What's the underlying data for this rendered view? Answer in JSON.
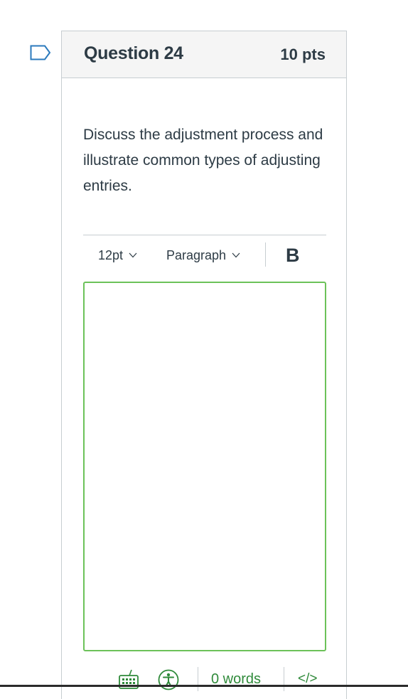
{
  "question": {
    "title": "Question 24",
    "points": "10 pts",
    "text": "Discuss the adjustment process and illustrate common types of adjusting entries."
  },
  "toolbar": {
    "font_size": "12pt",
    "block_format": "Paragraph",
    "bold_label": "B"
  },
  "editor": {
    "content": ""
  },
  "statusbar": {
    "word_count": "0 words",
    "html_toggle": "</>"
  },
  "colors": {
    "text": "#2d3b45",
    "border": "#c7cdd1",
    "header_bg": "#f5f5f5",
    "focus_green": "#6cc259",
    "status_green": "#2f8a3a",
    "flag_blue": "#2b7abc"
  },
  "icons": [
    "flag-question-icon",
    "chevron-down-icon",
    "keyboard-icon",
    "accessibility-icon"
  ]
}
